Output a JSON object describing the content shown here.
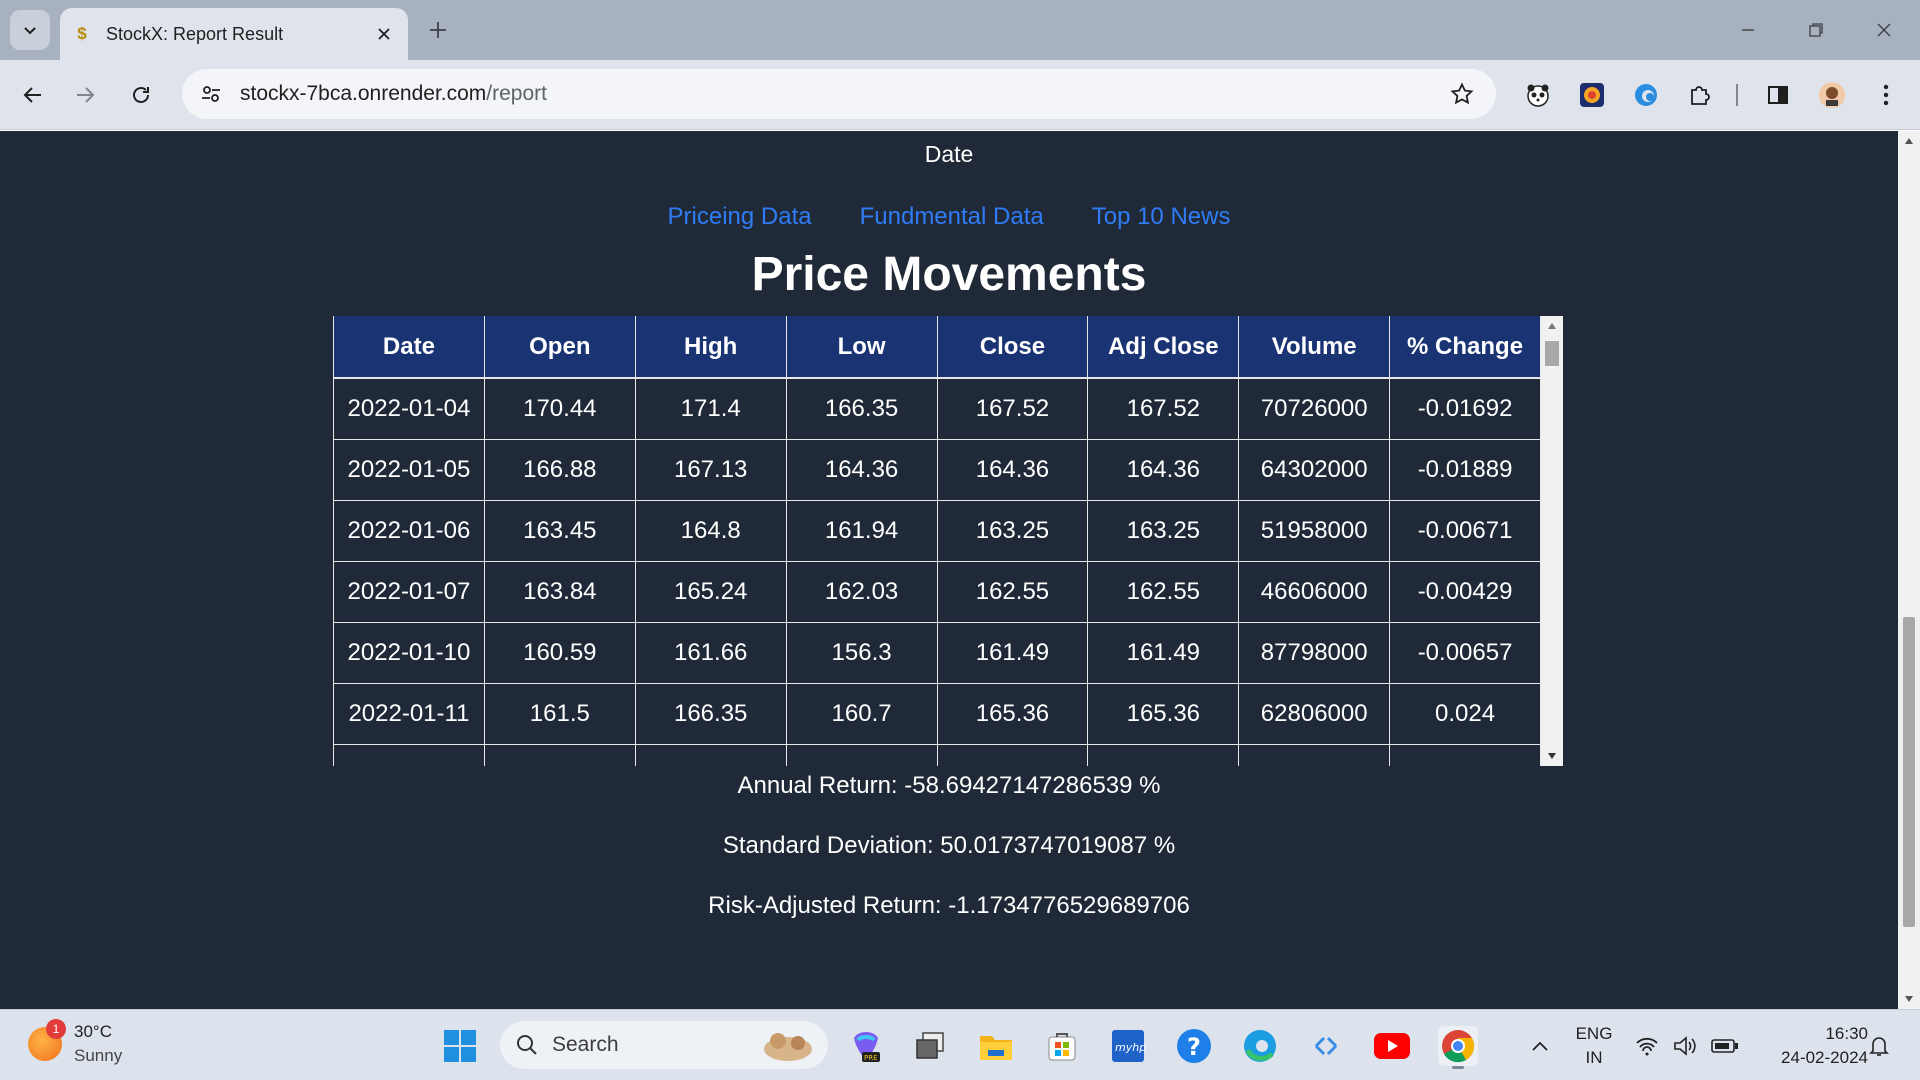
{
  "browser": {
    "tab_title": "StockX: Report Result",
    "url_host": "stockx-7bca.onrender.com",
    "url_path": "/report"
  },
  "page": {
    "date_heading": "Date",
    "links": [
      "Priceing Data",
      "Fundmental Data",
      "Top 10 News"
    ],
    "title": "Price Movements",
    "table": {
      "headers": [
        "Date",
        "Open",
        "High",
        "Low",
        "Close",
        "Adj Close",
        "Volume",
        "% Change"
      ],
      "rows": [
        [
          "2022-01-04",
          "170.44",
          "171.4",
          "166.35",
          "167.52",
          "167.52",
          "70726000",
          "-0.01692"
        ],
        [
          "2022-01-05",
          "166.88",
          "167.13",
          "164.36",
          "164.36",
          "164.36",
          "64302000",
          "-0.01889"
        ],
        [
          "2022-01-06",
          "163.45",
          "164.8",
          "161.94",
          "163.25",
          "163.25",
          "51958000",
          "-0.00671"
        ],
        [
          "2022-01-07",
          "163.84",
          "165.24",
          "162.03",
          "162.55",
          "162.55",
          "46606000",
          "-0.00429"
        ],
        [
          "2022-01-10",
          "160.59",
          "161.66",
          "156.3",
          "161.49",
          "161.49",
          "87798000",
          "-0.00657"
        ],
        [
          "2022-01-11",
          "161.5",
          "166.35",
          "160.7",
          "165.36",
          "165.36",
          "62806000",
          "0.024"
        ]
      ]
    },
    "stats": {
      "annual_return": "Annual Return: -58.69427147286539 %",
      "std_dev": "Standard Deviation: 50.0173747019087 %",
      "risk_adjusted": "Risk-Adjusted Return: -1.1734776529689706"
    }
  },
  "taskbar": {
    "temperature": "30°C",
    "condition": "Sunny",
    "weather_badge": "1",
    "search_placeholder": "Search",
    "language": "ENG",
    "region": "IN",
    "time": "16:30",
    "date": "24-02-2024"
  }
}
